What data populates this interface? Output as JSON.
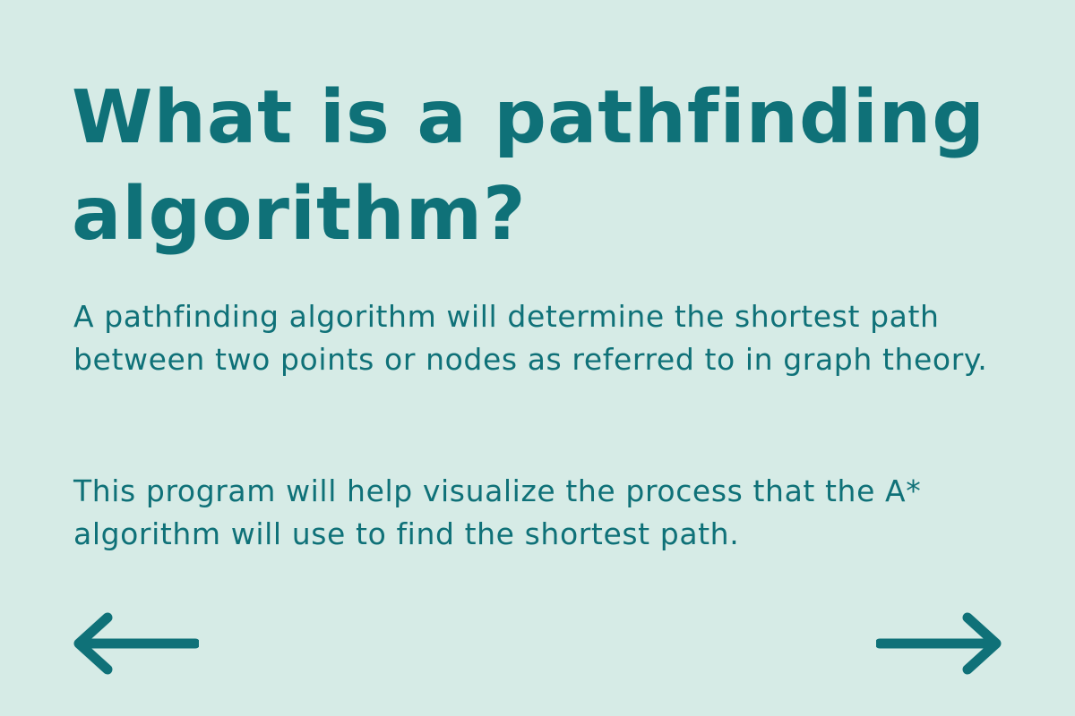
{
  "slide": {
    "title": "What is a pathfinding algorithm?",
    "paragraph_1": "A pathfinding algorithm will determine the shortest path between two points or nodes as referred to in graph theory.",
    "paragraph_2": "This program will help visualize the process that the A* algorithm will use to find the shortest path."
  },
  "navigation": {
    "prev_icon": "arrow-left-icon",
    "next_icon": "arrow-right-icon"
  },
  "colors": {
    "background": "#d6ebe6",
    "accent": "#0f7178"
  }
}
